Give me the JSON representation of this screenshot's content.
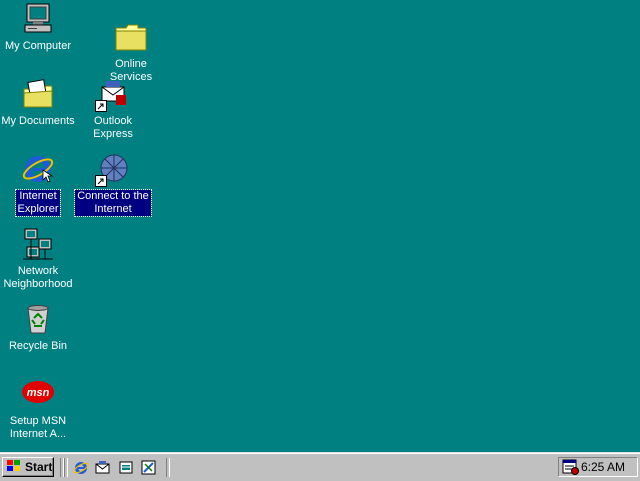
{
  "desktop": {
    "icons": [
      {
        "label": "My Computer"
      },
      {
        "label": "Online\nServices"
      },
      {
        "label": "My Documents"
      },
      {
        "label": "Outlook\nExpress"
      },
      {
        "label": "Internet\nExplorer"
      },
      {
        "label": "Connect to the\nInternet"
      },
      {
        "label": "Network\nNeighborhood"
      },
      {
        "label": "Recycle Bin"
      },
      {
        "label": "Setup MSN\nInternet A..."
      }
    ],
    "msn_logo_text": "msn"
  },
  "taskbar": {
    "start_label": "Start",
    "quick_launch": [
      "internet-explorer-icon",
      "outlook-express-icon",
      "show-desktop-icon",
      "channels-icon"
    ],
    "clock": "6:25 AM"
  },
  "colors": {
    "desktop": "#008080",
    "taskbar": "#c0c0c0",
    "selection": "#000080"
  }
}
